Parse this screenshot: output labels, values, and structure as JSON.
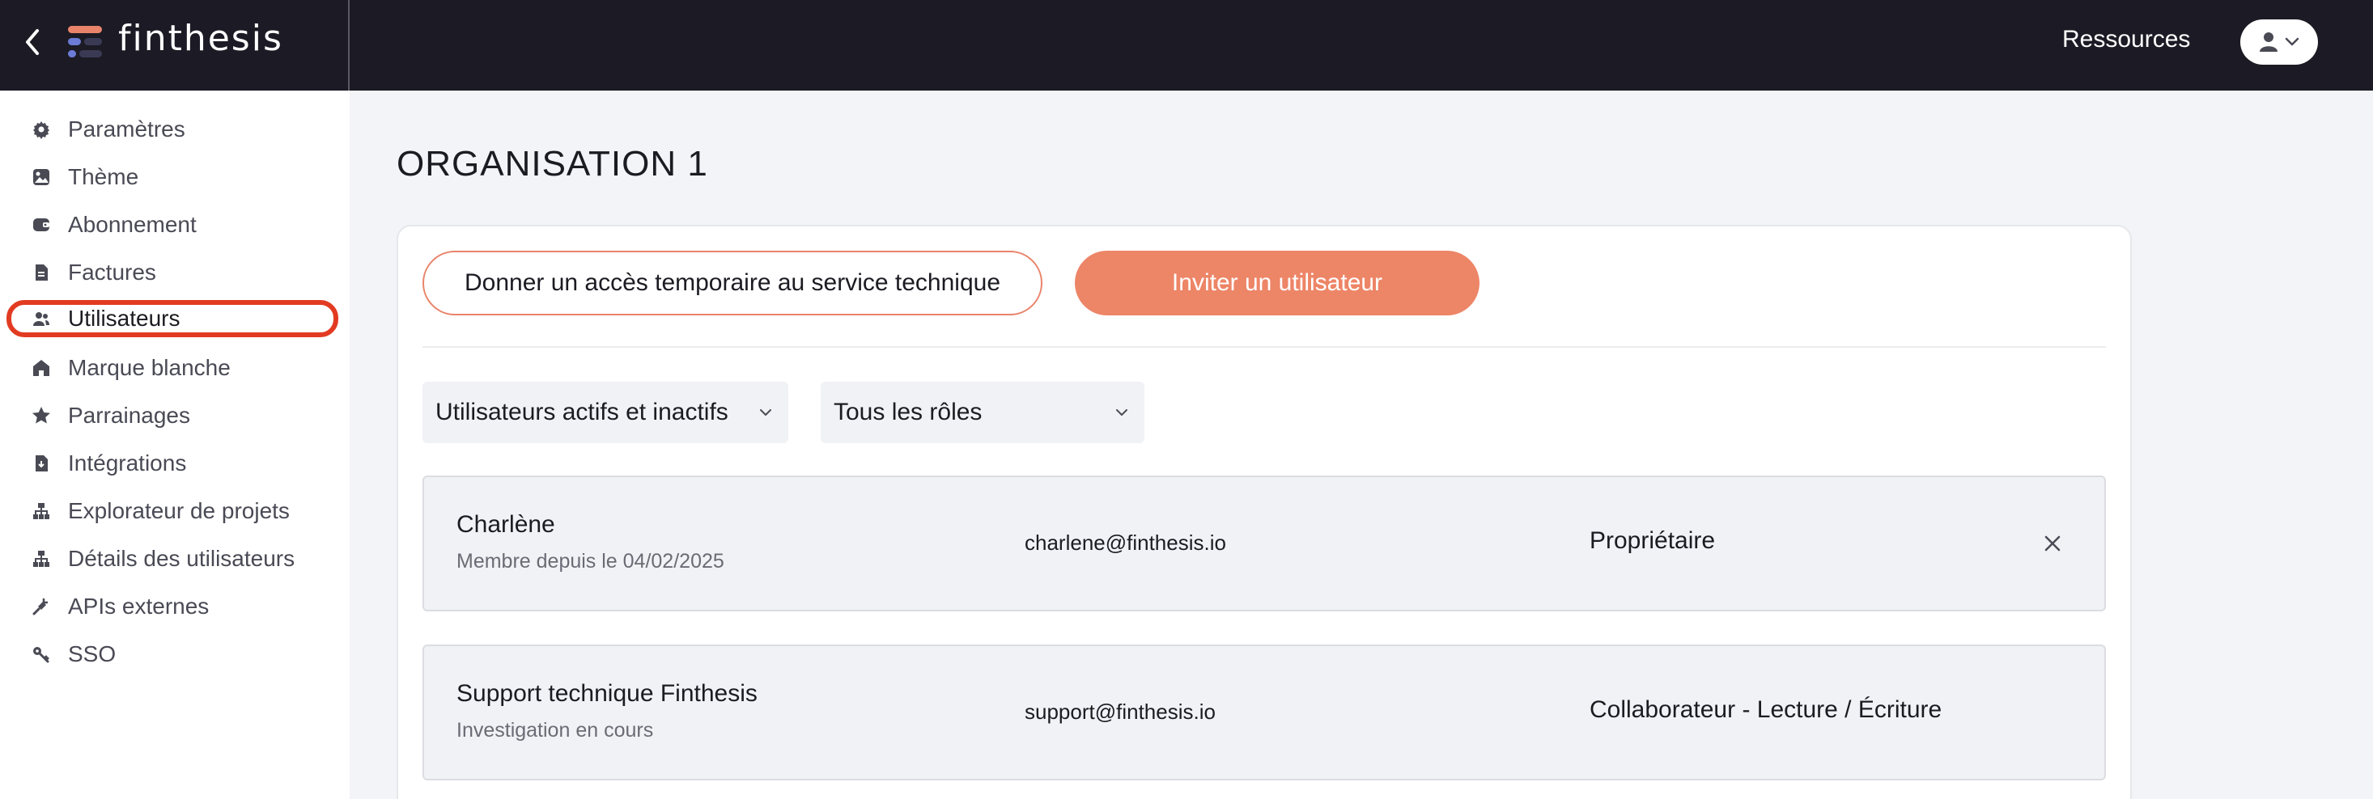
{
  "header": {
    "brand": "finthesis",
    "resources_label": "Ressources",
    "logo_colors": [
      "#e9846b",
      "#6b7bd6",
      "#3a3a55"
    ]
  },
  "sidebar": {
    "items": [
      {
        "label": "Paramètres",
        "icon": "gear-icon"
      },
      {
        "label": "Thème",
        "icon": "image-icon"
      },
      {
        "label": "Abonnement",
        "icon": "wallet-icon"
      },
      {
        "label": "Factures",
        "icon": "document-icon"
      },
      {
        "label": "Utilisateurs",
        "icon": "users-icon",
        "active": true
      },
      {
        "label": "Marque blanche",
        "icon": "home-icon"
      },
      {
        "label": "Parrainages",
        "icon": "star-icon"
      },
      {
        "label": "Intégrations",
        "icon": "download-doc-icon"
      },
      {
        "label": "Explorateur de projets",
        "icon": "hierarchy-icon"
      },
      {
        "label": "Détails des utilisateurs",
        "icon": "hierarchy-icon"
      },
      {
        "label": "APIs externes",
        "icon": "plug-icon"
      },
      {
        "label": "SSO",
        "icon": "key-icon"
      }
    ]
  },
  "main": {
    "title": "ORGANISATION 1",
    "temp_access_label": "Donner un accès temporaire au service technique",
    "invite_label": "Inviter un utilisateur",
    "filters": {
      "status": "Utilisateurs actifs et inactifs",
      "role": "Tous les rôles"
    },
    "users": [
      {
        "name": "Charlène",
        "subtitle": "Membre depuis le 04/02/2025",
        "email": "charlene@finthesis.io",
        "role": "Propriétaire",
        "removable": true
      },
      {
        "name": "Support technique Finthesis",
        "subtitle": "Investigation en cours",
        "email": "support@finthesis.io",
        "role": "Collaborateur - Lecture / Écriture",
        "removable": false
      }
    ]
  },
  "colors": {
    "accent": "#ed8567",
    "active_highlight": "#e23b22",
    "topbar": "#1c1b25"
  }
}
